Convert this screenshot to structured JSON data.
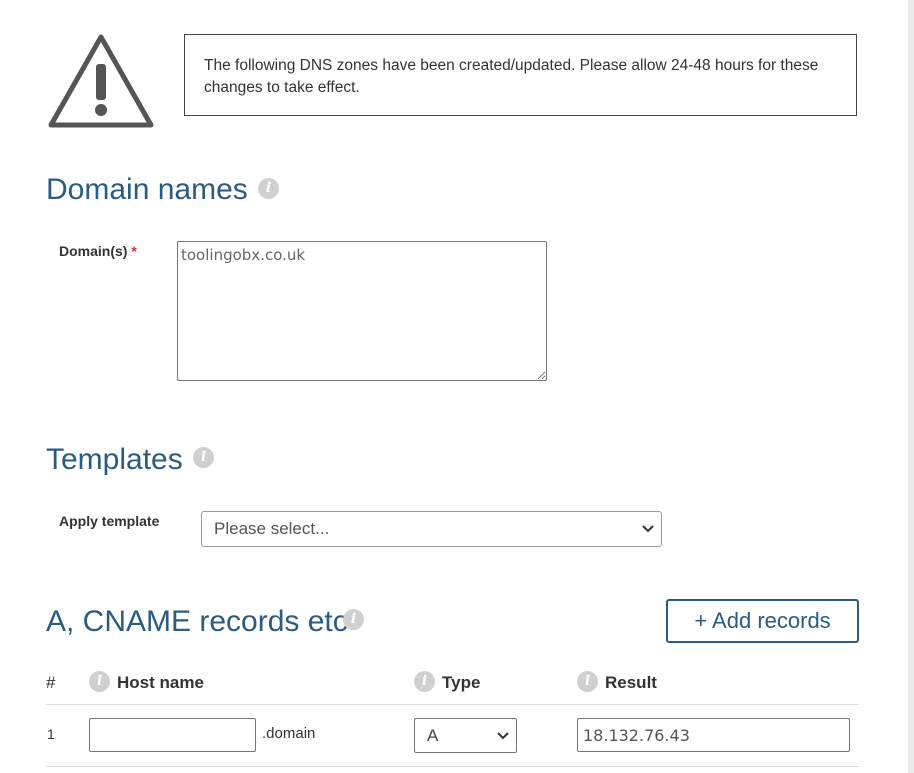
{
  "notice": {
    "icon": "warning-icon",
    "text": "The following DNS zones have been created/updated. Please allow 24-48 hours for these changes to take effect."
  },
  "domain_names": {
    "heading": "Domain names",
    "info_icon": "info-icon",
    "field_label": "Domain(s)",
    "required_marker": "*",
    "value": "toolingobx.co.uk"
  },
  "templates": {
    "heading": "Templates",
    "info_icon": "info-icon",
    "field_label": "Apply template",
    "selected": "Please select..."
  },
  "records": {
    "heading": "A, CNAME records etc",
    "info_icon": "info-icon",
    "add_button_label": "+ Add records",
    "columns": {
      "number": "#",
      "host": "Host name",
      "type": "Type",
      "result": "Result"
    },
    "rows": [
      {
        "number": "1",
        "host": "",
        "suffix": ".domain",
        "type": "A",
        "result": "18.132.76.43"
      }
    ]
  },
  "colors": {
    "heading": "#2b5b7f",
    "required": "#d9312b",
    "info_icon": "#d0d0d0"
  }
}
